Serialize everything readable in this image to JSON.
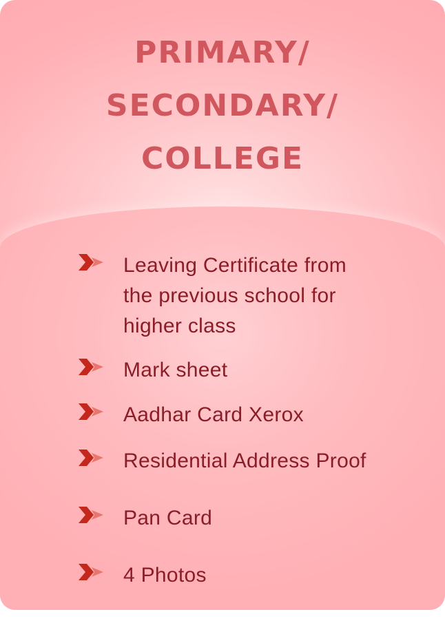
{
  "title_lines": [
    "PRIMARY/",
    "SECONDARY/",
    "COLLEGE"
  ],
  "documents": [
    {
      "label": "Leaving Certificate from the previous school for higher class",
      "lines": [
        "Leaving Certificate from",
        "the previous school for",
        "higher class"
      ]
    },
    {
      "label": "Mark sheet"
    },
    {
      "label": "Aadhar Card Xerox"
    },
    {
      "label": "Residential Address Proof"
    },
    {
      "label": "Pan Card"
    },
    {
      "label": "4 Photos"
    }
  ],
  "colors": {
    "title": "#d0575d",
    "text": "#8a1d27",
    "bullet_main": "#c4281c",
    "bullet_accent": "#e8766e"
  },
  "bullet_icon": "double-chevron-right-icon"
}
